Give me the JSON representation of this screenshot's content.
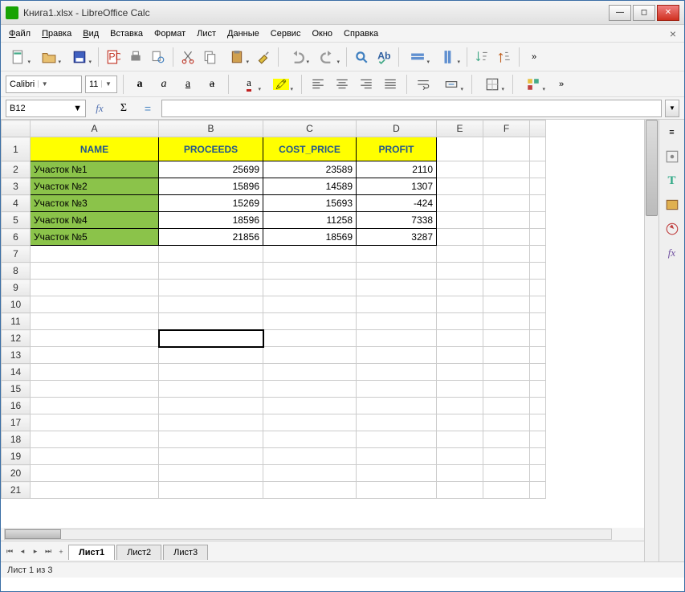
{
  "window": {
    "title": "Книга1.xlsx - LibreOffice Calc"
  },
  "menu": {
    "items": [
      "Файл",
      "Правка",
      "Вид",
      "Вставка",
      "Формат",
      "Лист",
      "Данные",
      "Сервис",
      "Окно",
      "Справка"
    ]
  },
  "format": {
    "font_name": "Calibri",
    "font_size": "11"
  },
  "namebox": {
    "value": "B12"
  },
  "columns": [
    "A",
    "B",
    "C",
    "D",
    "E",
    "F",
    ""
  ],
  "headers": {
    "a": "NAME",
    "b": "PROCEEDS",
    "c": "COST_PRICE",
    "d": "PROFIT"
  },
  "rows": [
    {
      "name": "Участок №1",
      "proceeds": "25699",
      "cost": "23589",
      "profit": "2110"
    },
    {
      "name": "Участок №2",
      "proceeds": "15896",
      "cost": "14589",
      "profit": "1307"
    },
    {
      "name": "Участок №3",
      "proceeds": "15269",
      "cost": "15693",
      "profit": "-424"
    },
    {
      "name": "Участок №4",
      "proceeds": "18596",
      "cost": "11258",
      "profit": "7338"
    },
    {
      "name": "Участок №5",
      "proceeds": "21856",
      "cost": "18569",
      "profit": "3287"
    }
  ],
  "row_numbers": [
    "1",
    "2",
    "3",
    "4",
    "5",
    "6",
    "7",
    "8",
    "9",
    "10",
    "11",
    "12",
    "13",
    "14",
    "15",
    "16",
    "17",
    "18",
    "19",
    "20",
    "21"
  ],
  "tabs": {
    "add": "+",
    "sheets": [
      "Лист1",
      "Лист2",
      "Лист3"
    ],
    "active": 0
  },
  "status": {
    "text": "Лист 1 из 3"
  },
  "selected": {
    "col": "B",
    "row": "12"
  },
  "chart_data": {
    "type": "table",
    "columns": [
      "NAME",
      "PROCEEDS",
      "COST_PRICE",
      "PROFIT"
    ],
    "data": [
      [
        "Участок №1",
        25699,
        23589,
        2110
      ],
      [
        "Участок №2",
        15896,
        14589,
        1307
      ],
      [
        "Участок №3",
        15269,
        15693,
        -424
      ],
      [
        "Участок №4",
        18596,
        11258,
        7338
      ],
      [
        "Участок №5",
        21856,
        18569,
        3287
      ]
    ]
  }
}
